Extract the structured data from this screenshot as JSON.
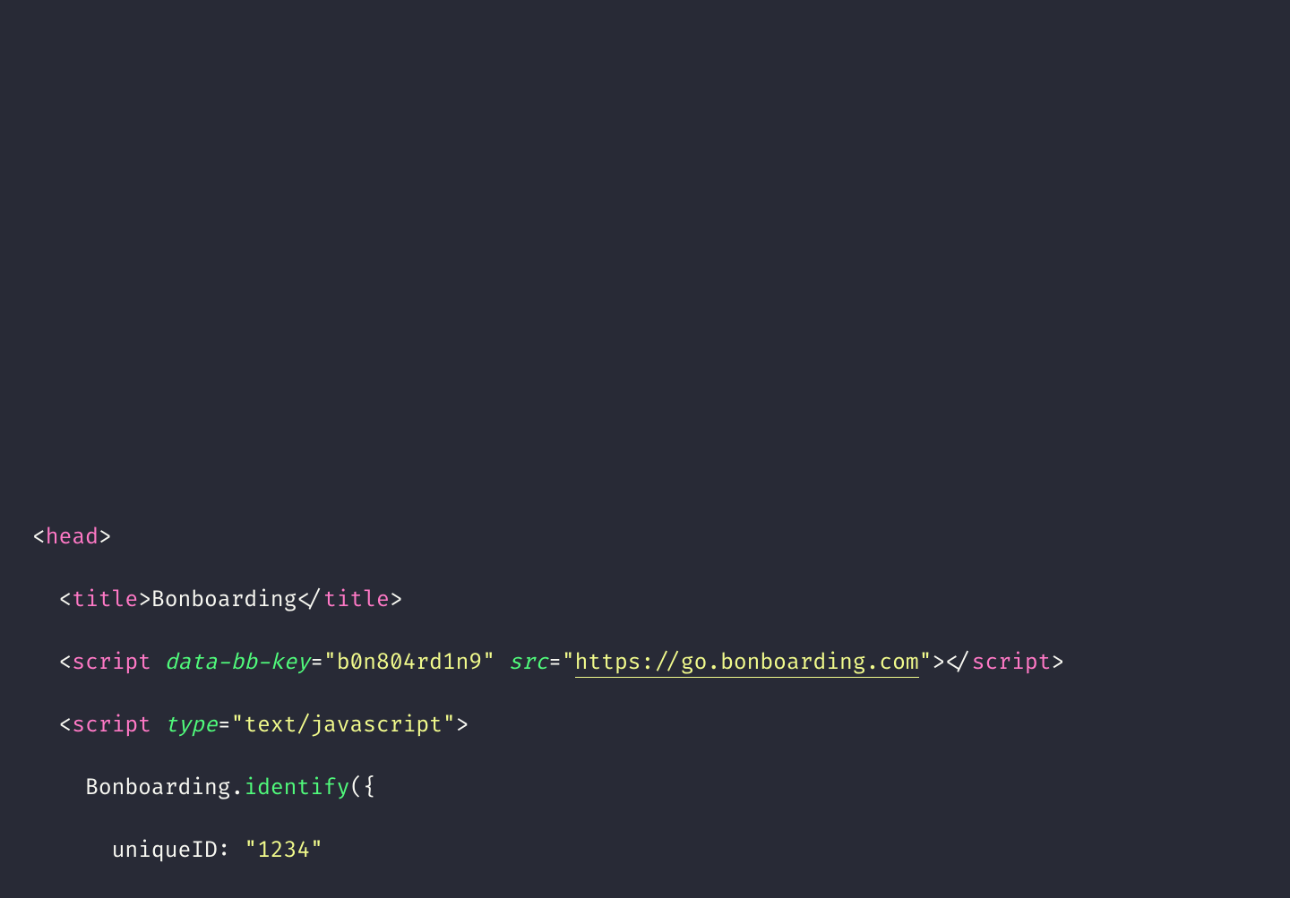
{
  "code": {
    "line1": {
      "lt": "<",
      "tag": "head",
      "gt": ">"
    },
    "line2": {
      "indent": "  ",
      "lt": "<",
      "tag": "title",
      "gt1": ">",
      "text": "Bonboarding",
      "lt2": "</",
      "tag2": "title",
      "gt2": ">"
    },
    "line3": {
      "indent": "  ",
      "lt": "<",
      "tag": "script",
      "sp1": " ",
      "attr1": "data-bb-key",
      "eq1": "=",
      "val1": "\"b0n804rd1n9\"",
      "sp2": " ",
      "attr2": "src",
      "eq2": "=",
      "q1": "\"",
      "url": "https://go.bonboarding.com",
      "q2": "\"",
      "gt1": ">",
      "lt2": "</",
      "tag2": "script",
      "gt2": ">"
    },
    "line4": {
      "indent": "  ",
      "lt": "<",
      "tag": "script",
      "sp1": " ",
      "attr1": "type",
      "eq1": "=",
      "val1": "\"text/javascript\"",
      "gt1": ">"
    },
    "line5": {
      "indent": "    ",
      "obj": "Bonboarding",
      "dot": ".",
      "fn": "identify",
      "paren": "({"
    },
    "line6": {
      "indent": "      ",
      "key": "uniqueID",
      "colon": ": ",
      "val": "\"1234\""
    }
  }
}
